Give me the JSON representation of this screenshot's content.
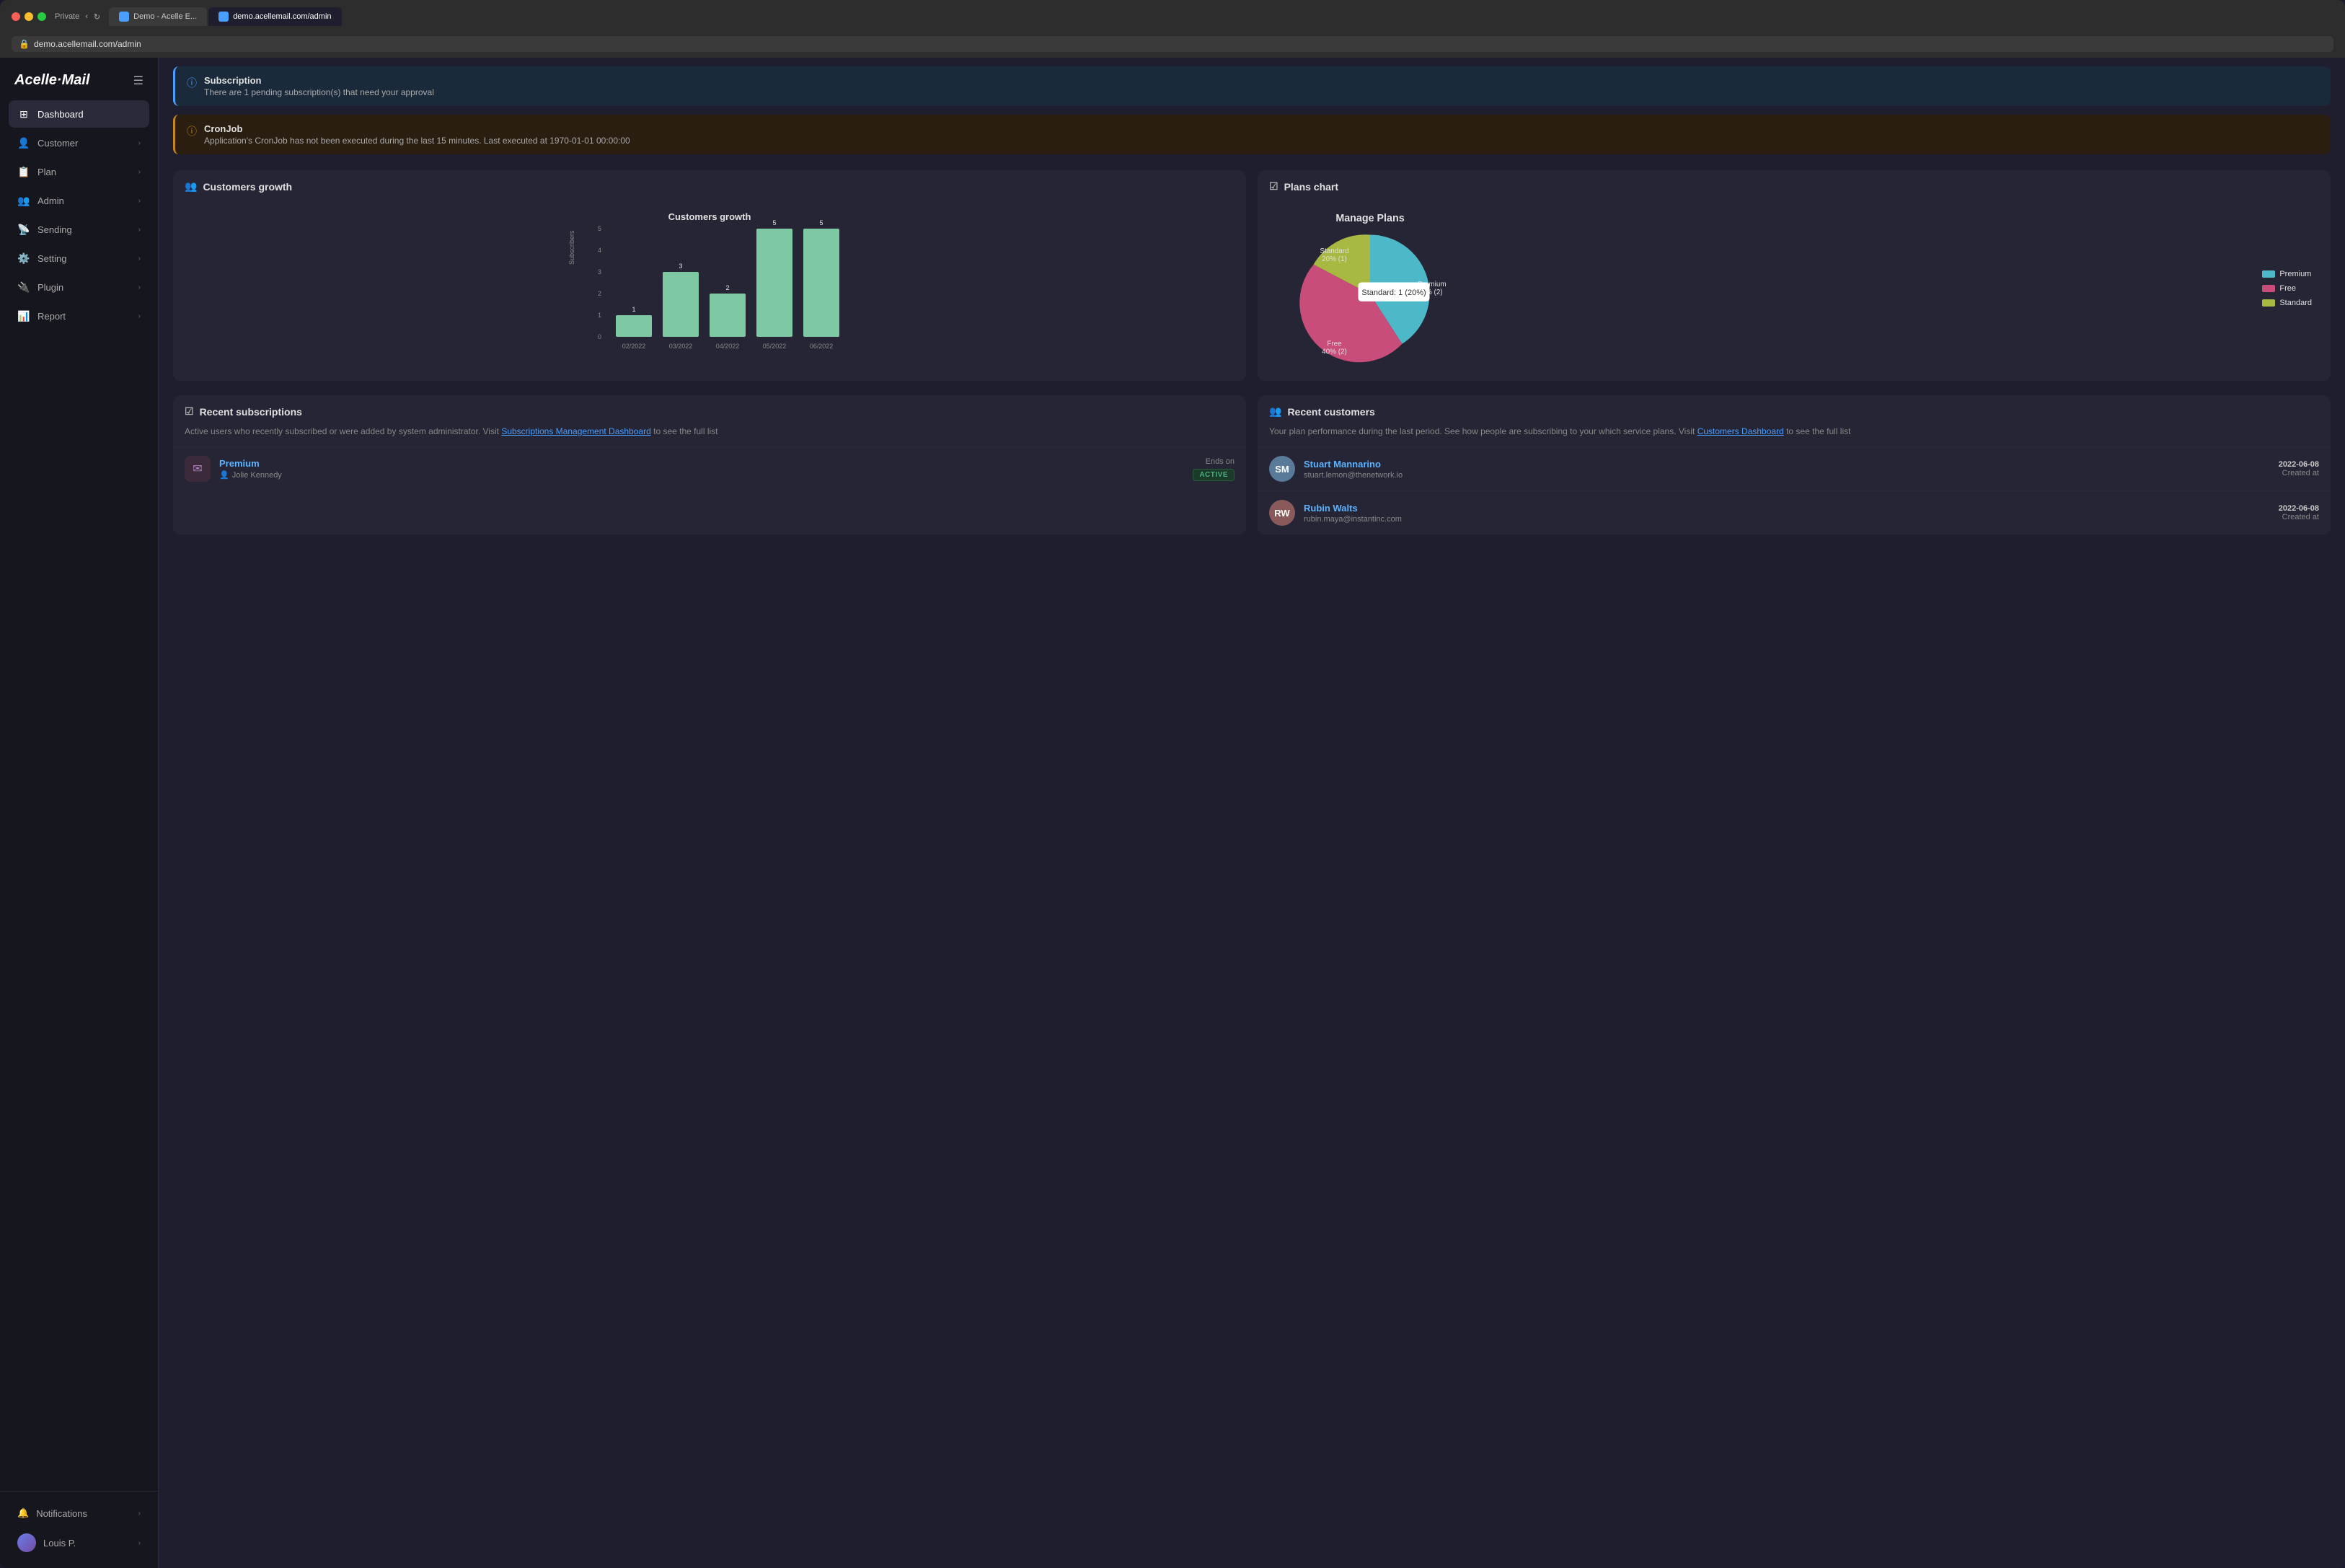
{
  "browser": {
    "tab1_label": "Demo - Acelle E...",
    "tab2_label": "demo.acellemail.com/admin",
    "tab2_url": "demo.acellemail.com/admin",
    "lock_icon": "🔒",
    "private_label": "Private"
  },
  "sidebar": {
    "logo": "Acelle·Mail",
    "items": [
      {
        "id": "dashboard",
        "label": "Dashboard",
        "icon": "⊞",
        "active": true,
        "has_chevron": false
      },
      {
        "id": "customer",
        "label": "Customer",
        "icon": "👤",
        "active": false,
        "has_chevron": true
      },
      {
        "id": "plan",
        "label": "Plan",
        "icon": "📋",
        "active": false,
        "has_chevron": true
      },
      {
        "id": "admin",
        "label": "Admin",
        "icon": "👥",
        "active": false,
        "has_chevron": true
      },
      {
        "id": "sending",
        "label": "Sending",
        "icon": "📡",
        "active": false,
        "has_chevron": true
      },
      {
        "id": "setting",
        "label": "Setting",
        "icon": "⚙️",
        "active": false,
        "has_chevron": true
      },
      {
        "id": "plugin",
        "label": "Plugin",
        "icon": "🔌",
        "active": false,
        "has_chevron": true
      },
      {
        "id": "report",
        "label": "Report",
        "icon": "📊",
        "active": false,
        "has_chevron": true
      }
    ],
    "notifications": {
      "label": "Notifications",
      "icon": "🔔"
    },
    "user": {
      "name": "Louis P.",
      "icon": "👤"
    }
  },
  "alerts": [
    {
      "id": "subscription",
      "type": "info",
      "title": "Subscription",
      "text": "There are 1 pending subscription(s) that need your approval"
    },
    {
      "id": "cronjob",
      "type": "warning",
      "title": "CronJob",
      "text": "Application's CronJob has not been executed during the last 15 minutes. Last executed at 1970-01-01 00:00:00"
    }
  ],
  "customers_growth": {
    "section_title": "Customers growth",
    "chart_title": "Customers growth",
    "y_label": "Subscribers",
    "y_ticks": [
      "5",
      "4",
      "3",
      "2",
      "1",
      "0"
    ],
    "bars": [
      {
        "label": "02/2022",
        "value": 1
      },
      {
        "label": "03/2022",
        "value": 3
      },
      {
        "label": "04/2022",
        "value": 2
      },
      {
        "label": "05/2022",
        "value": 5
      },
      {
        "label": "06/2022",
        "value": 5
      }
    ],
    "max_value": 5
  },
  "plans_chart": {
    "section_title": "Plans chart",
    "chart_title": "Manage Plans",
    "segments": [
      {
        "label": "Premium",
        "percent": 40,
        "count": 2,
        "color": "#4db8c8"
      },
      {
        "label": "Free",
        "percent": 40,
        "count": 2,
        "color": "#c84d7a"
      },
      {
        "label": "Standard",
        "percent": 20,
        "count": 1,
        "color": "#a8b840"
      }
    ],
    "tooltip": "Standard: 1 (20%)",
    "label_premium_pos": "40% (2)",
    "label_free_pos": "40% (2)",
    "label_standard_pos": "20% (1)"
  },
  "recent_subscriptions": {
    "section_title": "Recent subscriptions",
    "description": "Active users who recently subscribed or were added by system administrator. Visit",
    "link_text": "Subscriptions Management Dashboard",
    "link_suffix": "to see the full list",
    "items": [
      {
        "plan": "Premium",
        "user": "Jolie Kennedy",
        "ends_label": "Ends on",
        "status": "ACTIVE"
      }
    ]
  },
  "recent_customers": {
    "section_title": "Recent customers",
    "description": "Your plan performance during the last period. See how people are subscribing to your which service plans. Visit",
    "link_text": "Customers Dashboard",
    "link_suffix": "to see the full list",
    "items": [
      {
        "name": "Stuart Mannarino",
        "email": "stuart.lemon@thenetwork.io",
        "date": "2022-06-08",
        "date_label": "Created at",
        "initials": "SM",
        "color": "#5a7a9a"
      },
      {
        "name": "Rubin Walts",
        "email": "rubin.maya@instantinc.com",
        "date": "2022-06-08",
        "date_label": "Created at",
        "initials": "RW",
        "color": "#8a5a5a"
      }
    ]
  }
}
